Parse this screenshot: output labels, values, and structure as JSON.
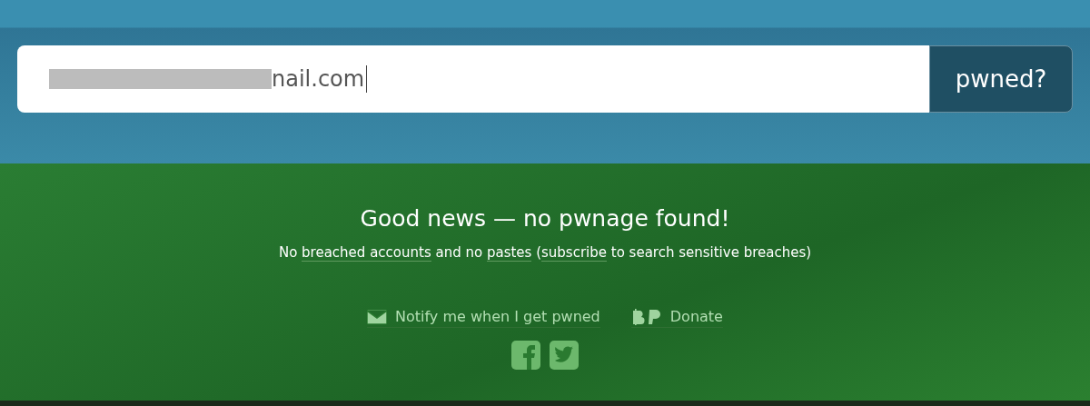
{
  "search": {
    "value": "nail.com",
    "redacted": true,
    "button": "pwned?"
  },
  "result": {
    "title": "Good news — no pwnage found!",
    "summary": [
      {
        "kind": "text",
        "text": "No "
      },
      {
        "kind": "link",
        "text": "breached accounts"
      },
      {
        "kind": "text",
        "text": " and no "
      },
      {
        "kind": "link",
        "text": "pastes"
      },
      {
        "kind": "text",
        "text": " ("
      },
      {
        "kind": "link",
        "text": "subscribe"
      },
      {
        "kind": "text",
        "text": " to search sensitive breaches)"
      }
    ]
  },
  "actions": [
    {
      "kind": "notify",
      "label": "Notify me when I get pwned"
    },
    {
      "kind": "donate",
      "label": "Donate"
    }
  ],
  "social": [
    {
      "kind": "facebook"
    },
    {
      "kind": "twitter"
    }
  ]
}
